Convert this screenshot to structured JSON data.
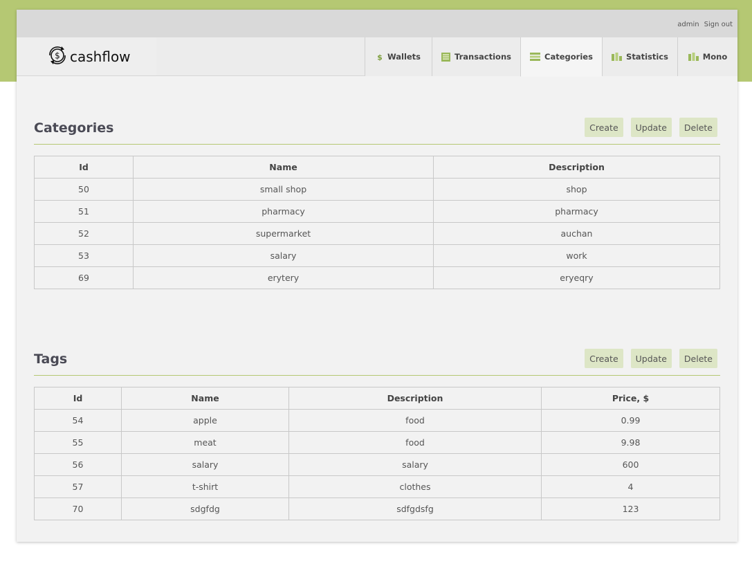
{
  "colors": {
    "accent": "#b5c873",
    "button_bg": "#dde6c6"
  },
  "topbar": {
    "user": "admin",
    "signout": "Sign out"
  },
  "logo": {
    "text": "cashflow",
    "icon": "dollar-cycle-icon"
  },
  "nav": {
    "tabs": [
      {
        "label": "Wallets",
        "icon": "dollar-icon"
      },
      {
        "label": "Transactions",
        "icon": "list-icon"
      },
      {
        "label": "Categories",
        "icon": "stack-icon",
        "active": true
      },
      {
        "label": "Statistics",
        "icon": "bar-chart-icon"
      },
      {
        "label": "Mono",
        "icon": "bar-chart-icon"
      }
    ]
  },
  "categories": {
    "title": "Categories",
    "actions": {
      "create": "Create",
      "update": "Update",
      "delete": "Delete"
    },
    "columns": [
      "Id",
      "Name",
      "Description"
    ],
    "rows": [
      [
        "50",
        "small shop",
        "shop"
      ],
      [
        "51",
        "pharmacy",
        "pharmacy"
      ],
      [
        "52",
        "supermarket",
        "auchan"
      ],
      [
        "53",
        "salary",
        "work"
      ],
      [
        "69",
        "erytery",
        "eryeqry"
      ]
    ]
  },
  "tags": {
    "title": "Tags",
    "actions": {
      "create": "Create",
      "update": "Update",
      "delete": "Delete"
    },
    "columns": [
      "Id",
      "Name",
      "Description",
      "Price, $"
    ],
    "rows": [
      [
        "54",
        "apple",
        "food",
        "0.99"
      ],
      [
        "55",
        "meat",
        "food",
        "9.98"
      ],
      [
        "56",
        "salary",
        "salary",
        "600"
      ],
      [
        "57",
        "t-shirt",
        "clothes",
        "4"
      ],
      [
        "70",
        "sdgfdg",
        "sdfgdsfg",
        "123"
      ]
    ]
  }
}
